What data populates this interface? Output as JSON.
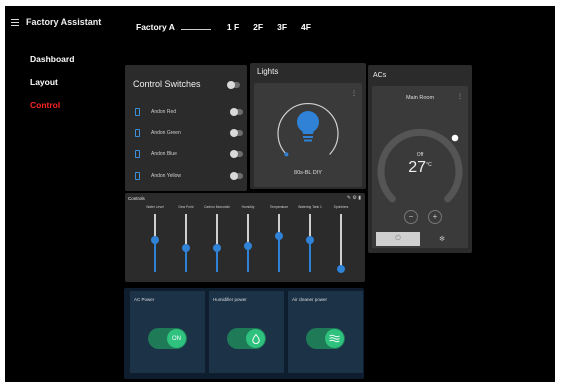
{
  "app": {
    "title": "Factory Assistant"
  },
  "nav": {
    "items": [
      {
        "label": "Dashboard",
        "active": false
      },
      {
        "label": "Layout",
        "active": false
      },
      {
        "label": "Control",
        "active": true
      }
    ]
  },
  "header": {
    "factory": "Factory A",
    "floors": [
      "1 F",
      "2F",
      "3F",
      "4F"
    ]
  },
  "control_switches": {
    "title": "Control Switches",
    "master_on": false,
    "items": [
      {
        "label": "Andon Red",
        "on": false,
        "icon": "phone-icon"
      },
      {
        "label": "Andon Green",
        "on": false,
        "icon": "phone-icon"
      },
      {
        "label": "Andon Blue",
        "on": false,
        "icon": "phone-icon"
      },
      {
        "label": "Andon Yellow",
        "on": false,
        "icon": "phone-icon"
      }
    ]
  },
  "lights": {
    "title": "Lights",
    "device_name": "80s-BL DIY",
    "icon": "lightbulb-icon",
    "level_fraction": 0.05
  },
  "acs": {
    "title": "ACs",
    "room": "Main Room",
    "status": "Off",
    "temperature": "27",
    "unit": "°C",
    "minus_label": "−",
    "plus_label": "+"
  },
  "controls": {
    "title": "Controls",
    "sliders": [
      {
        "label": "Water Level",
        "level": 0.55
      },
      {
        "label": "Dew Point",
        "level": 0.42
      },
      {
        "label": "Carbon Monoxide",
        "level": 0.42
      },
      {
        "label": "Humidity",
        "level": 0.45
      },
      {
        "label": "Temperature",
        "level": 0.62
      },
      {
        "label": "Watering Tank 1",
        "level": 0.55
      },
      {
        "label": "Sprinklers",
        "level": 0.05
      }
    ]
  },
  "power": {
    "items": [
      {
        "label": "AC Power",
        "knob_text": "ON",
        "icon": ""
      },
      {
        "label": "Humidifier power",
        "knob_text": "",
        "icon": "droplet-icon"
      },
      {
        "label": "Air cleaner power",
        "knob_text": "",
        "icon": "air-waves-icon"
      }
    ]
  },
  "colors": {
    "accent_blue": "#2f82d6",
    "active_nav": "#ff2424",
    "power_green": "#2ec27e"
  }
}
